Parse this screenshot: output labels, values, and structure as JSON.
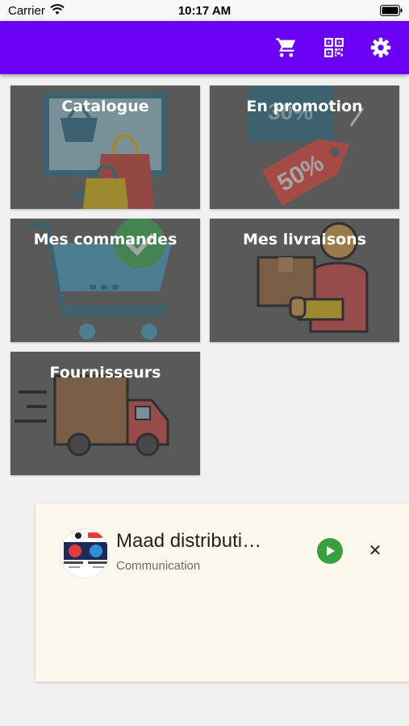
{
  "status_bar": {
    "carrier": "Carrier",
    "time": "10:17 AM",
    "wifi_icon": "wifi-icon",
    "battery_icon": "battery-icon"
  },
  "app_bar": {
    "background_color": "#6a00f4",
    "actions": [
      {
        "icon": "cart-icon"
      },
      {
        "icon": "qr-code-icon"
      },
      {
        "icon": "gear-icon"
      }
    ]
  },
  "tiles": [
    {
      "label": "Catalogue",
      "icon": "shopping-catalog-icon"
    },
    {
      "label": "En promotion",
      "icon": "discount-tag-icon",
      "tag_text": "50%",
      "tag_text_back": "30%"
    },
    {
      "label": "Mes commandes",
      "icon": "shopping-cart-check-icon"
    },
    {
      "label": "Mes livraisons",
      "icon": "delivery-person-icon"
    },
    {
      "label": "Fournisseurs",
      "icon": "delivery-truck-icon"
    }
  ],
  "ad": {
    "title": "Maad distributi…",
    "subtitle": "Communication",
    "play_icon": "play-icon",
    "close_label": "✕",
    "accent_color": "#3aa03f"
  }
}
